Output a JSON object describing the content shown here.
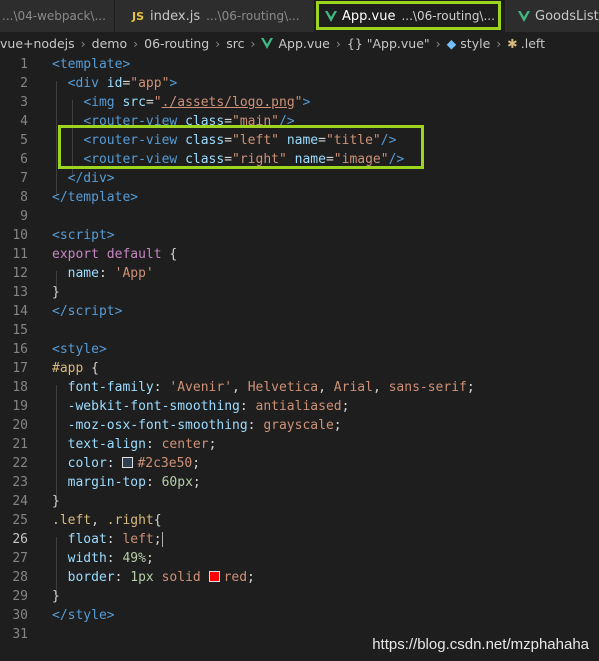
{
  "tabs": [
    {
      "name": "",
      "path": "...\\04-webpack\\...",
      "icon": "none"
    },
    {
      "name": "index.js",
      "path": "...\\06-routing\\...",
      "icon": "js-icon"
    },
    {
      "name": "App.vue",
      "path": "...\\06-routing\\...",
      "icon": "vue-icon",
      "active": true,
      "close": "×"
    },
    {
      "name": "GoodsList.vue",
      "path": "",
      "icon": "vue-icon"
    }
  ],
  "js_icon_text": "JS",
  "breadcrumb": {
    "items": [
      "vue+nodejs",
      "demo",
      "06-routing",
      "src",
      "App.vue",
      "{} \"App.vue\"",
      "style",
      ".left"
    ],
    "separator": "›"
  },
  "editor": {
    "line_numbers": [
      "1",
      "2",
      "3",
      "4",
      "5",
      "6",
      "7",
      "8",
      "9",
      "10",
      "11",
      "12",
      "13",
      "14",
      "15",
      "16",
      "17",
      "18",
      "19",
      "20",
      "21",
      "22",
      "23",
      "24",
      "25",
      "26",
      "27",
      "28",
      "29",
      "30",
      "31"
    ],
    "current_line": "26",
    "color_values": {
      "color_2c3e50": "#2c3e50",
      "red": "#ff0000"
    }
  },
  "colors": {
    "highlight": "#9cd41f",
    "vue": "#41b883",
    "js": "#e8c43c"
  },
  "watermark": "https://blog.csdn.net/mzphahaha"
}
